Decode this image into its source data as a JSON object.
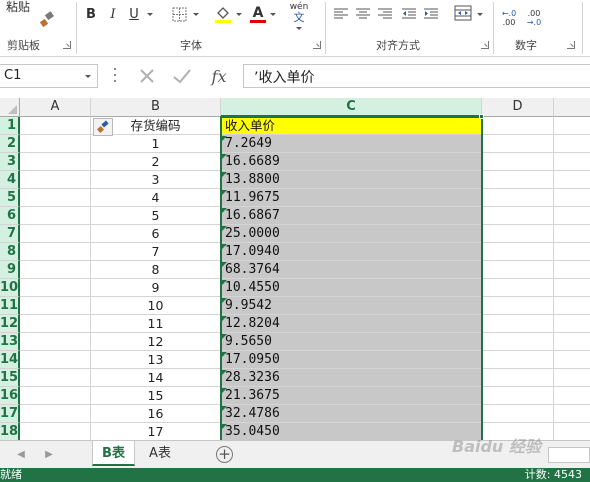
{
  "ribbon": {
    "clipboard": {
      "label": "剪贴板",
      "paste_label": "粘贴"
    },
    "font": {
      "label": "字体",
      "bold": "B",
      "italic": "I",
      "underline": "U",
      "font_color_glyph": "A",
      "pinyin_glyph": "wén"
    },
    "alignment": {
      "label": "对齐方式"
    },
    "number": {
      "label": "数字"
    }
  },
  "formula_bar": {
    "name_box": "C1",
    "fx": "fx",
    "content": "’收入单价"
  },
  "columns": [
    "A",
    "B",
    "C",
    "D"
  ],
  "rows": [
    {
      "num": "1",
      "b": "存货编码",
      "c": "收入单价"
    },
    {
      "num": "2",
      "b": "1",
      "c": "7.2649"
    },
    {
      "num": "3",
      "b": "2",
      "c": "16.6689"
    },
    {
      "num": "4",
      "b": "3",
      "c": "13.8800"
    },
    {
      "num": "5",
      "b": "4",
      "c": "11.9675"
    },
    {
      "num": "6",
      "b": "5",
      "c": "16.6867"
    },
    {
      "num": "7",
      "b": "6",
      "c": "25.0000"
    },
    {
      "num": "8",
      "b": "7",
      "c": "17.0940"
    },
    {
      "num": "9",
      "b": "8",
      "c": "68.3764"
    },
    {
      "num": "10",
      "b": "9",
      "c": "10.4550"
    },
    {
      "num": "11",
      "b": "10",
      "c": "9.9542"
    },
    {
      "num": "12",
      "b": "11",
      "c": "12.8204"
    },
    {
      "num": "13",
      "b": "12",
      "c": "9.5650"
    },
    {
      "num": "14",
      "b": "13",
      "c": "17.0950"
    },
    {
      "num": "15",
      "b": "14",
      "c": "28.3236"
    },
    {
      "num": "16",
      "b": "15",
      "c": "21.3675"
    },
    {
      "num": "17",
      "b": "16",
      "c": "32.4786"
    },
    {
      "num": "18",
      "b": "17",
      "c": "35.0450"
    }
  ],
  "sheets": [
    "B表",
    "A表"
  ],
  "active_sheet": "B表",
  "status": {
    "ready": "就绪",
    "count": "计数: 4543"
  },
  "watermark": "Baidu 经验",
  "colors": {
    "accent": "#217346",
    "header_fill": "#ffff00",
    "selection_fill": "#c8c8c8"
  }
}
